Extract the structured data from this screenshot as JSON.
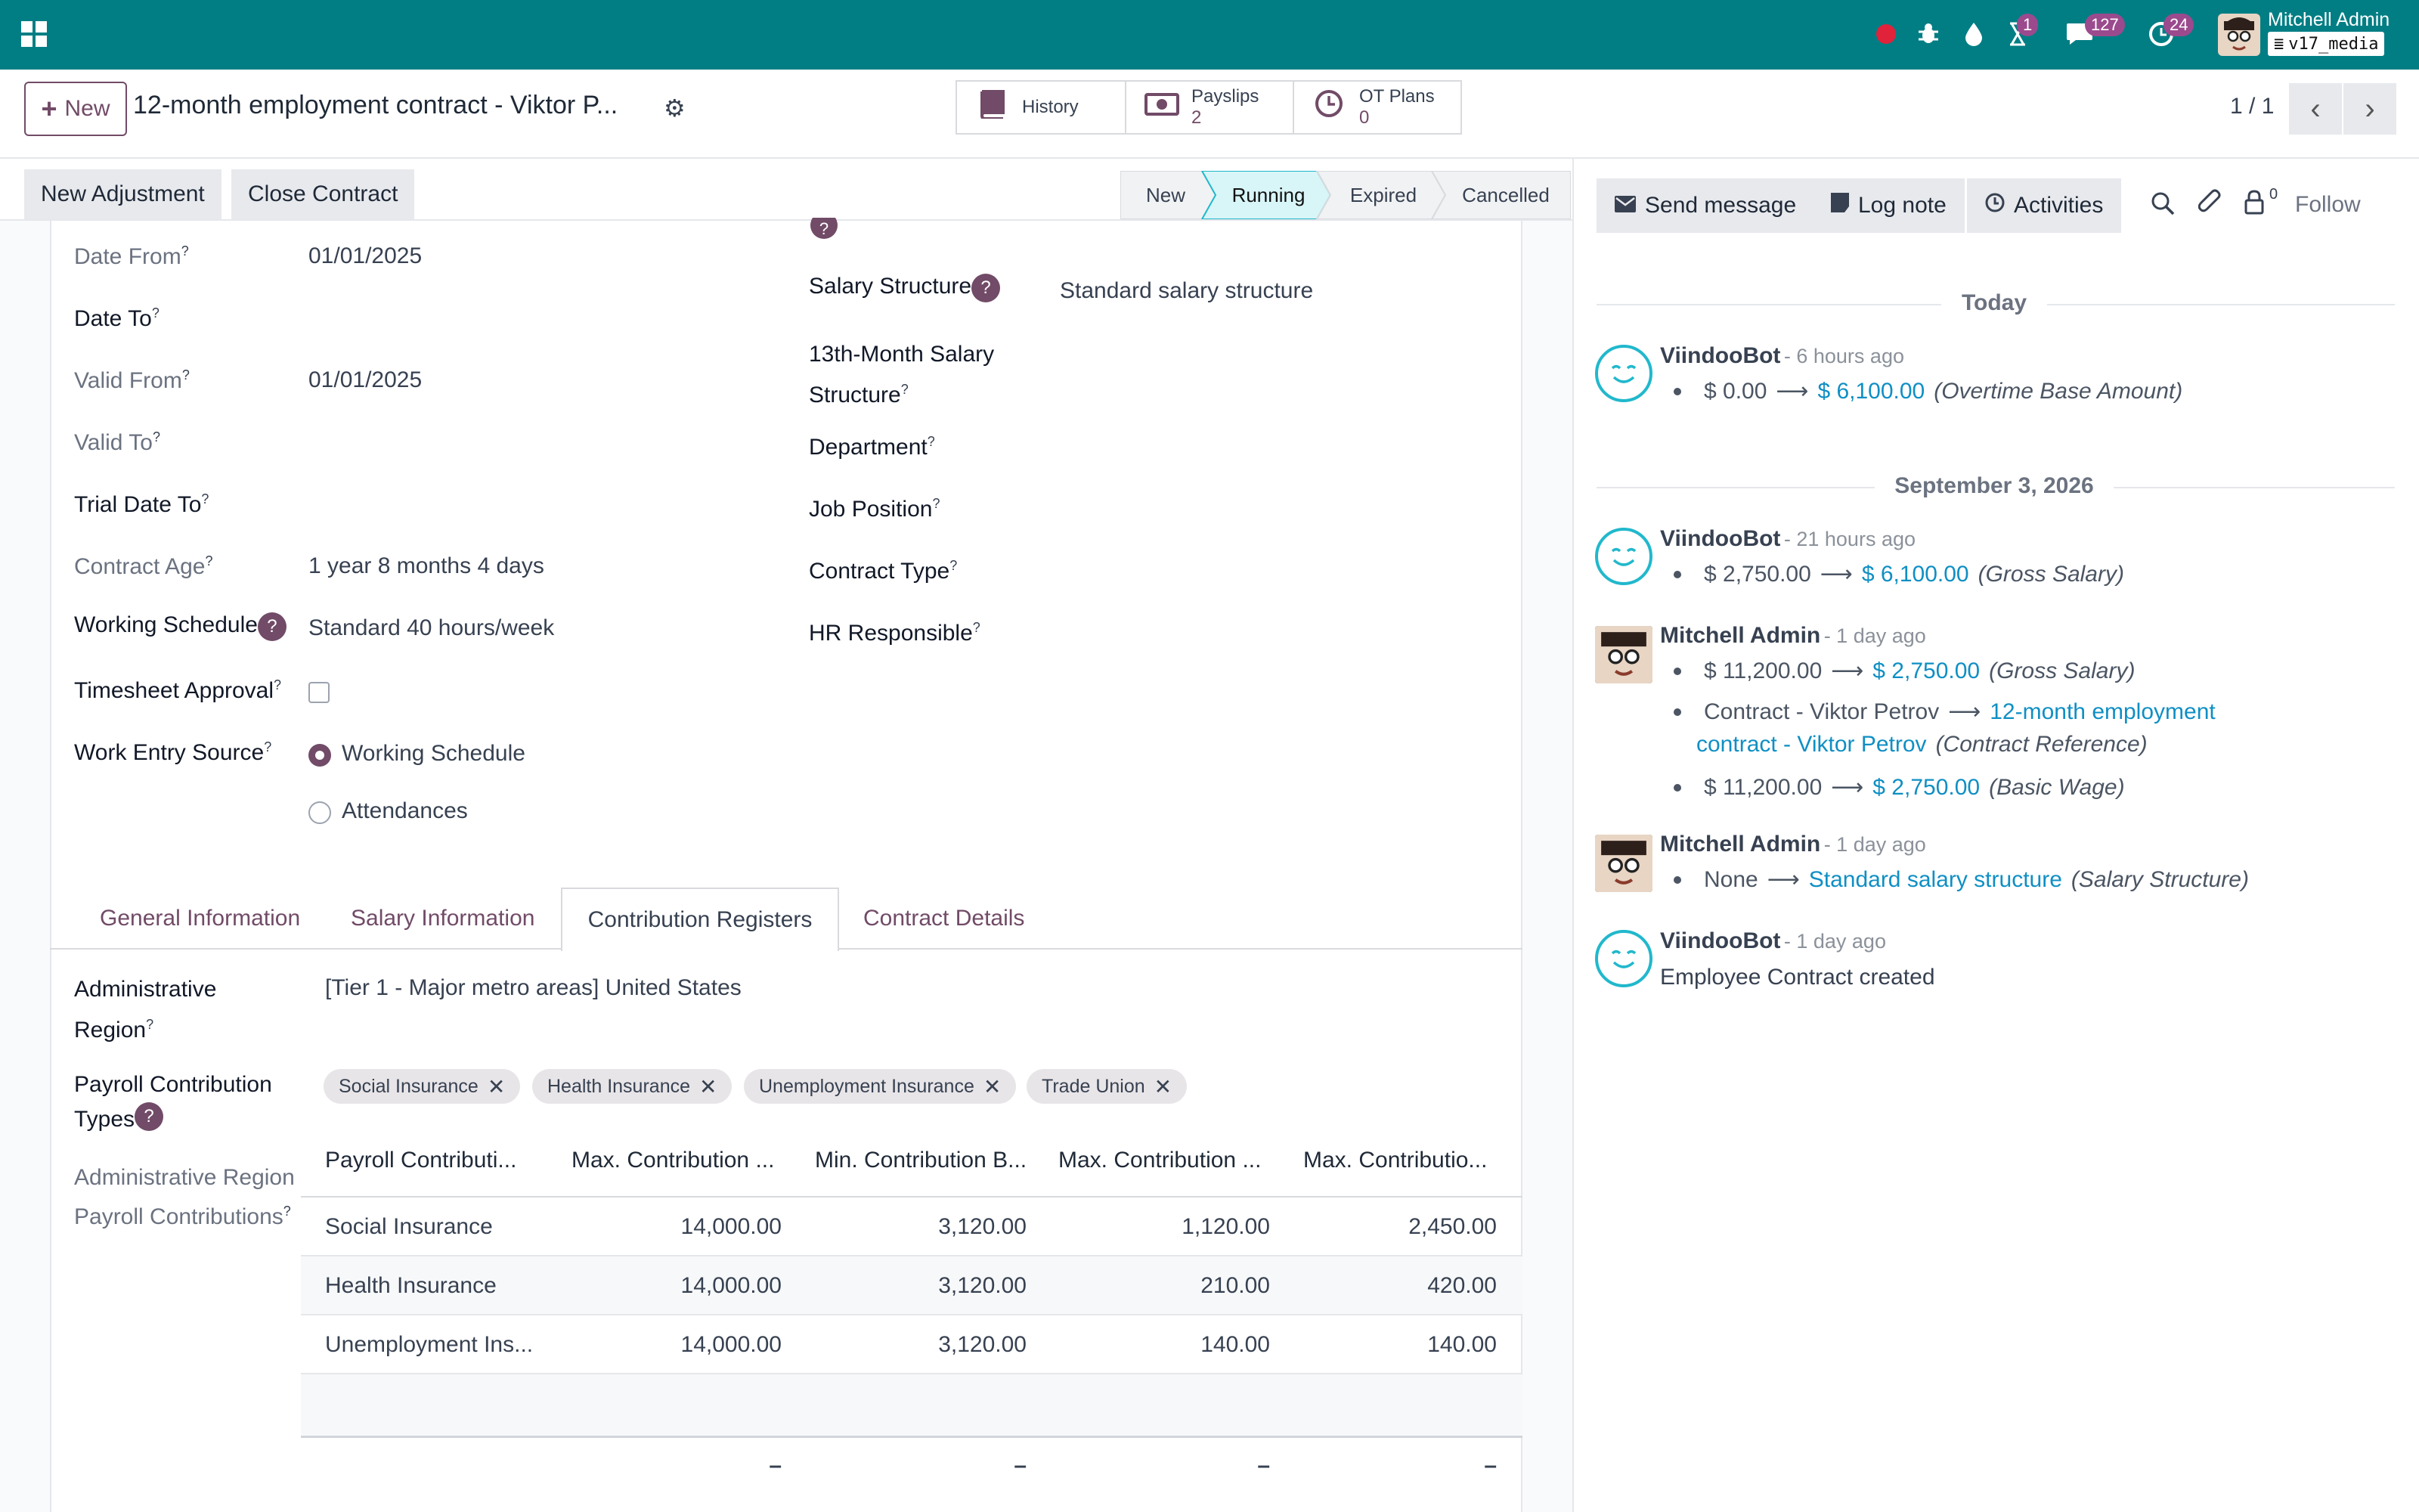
{
  "navbar": {
    "badges": {
      "activities": "1",
      "messages": "127",
      "updates": "24"
    },
    "user_name": "Mitchell Admin",
    "db_name": "v17_media"
  },
  "control": {
    "new_label": "New",
    "record_title": "12-month employment contract - Viktor P...",
    "smart_buttons": [
      {
        "label": "History",
        "count": ""
      },
      {
        "label": "Payslips",
        "count": "2"
      },
      {
        "label": "OT Plans",
        "count": "0"
      }
    ],
    "pager": "1 / 1"
  },
  "actions": {
    "adjustment": "New Adjustment",
    "close": "Close Contract"
  },
  "stages": [
    "New",
    "Running",
    "Expired",
    "Cancelled"
  ],
  "form_left": [
    {
      "label": "Date From",
      "value": "01/01/2025",
      "muted": true
    },
    {
      "label": "Date To",
      "value": "",
      "muted": false
    },
    {
      "label": "Valid From",
      "value": "01/01/2025",
      "muted": true
    },
    {
      "label": "Valid To",
      "value": "",
      "muted": true
    },
    {
      "label": "Trial Date To",
      "value": "",
      "muted": false
    },
    {
      "label": "Contract Age",
      "value": "1 year 8 months 4 days",
      "muted": true
    },
    {
      "label": "Working Schedule",
      "value": "Standard 40 hours/week",
      "muted": false
    },
    {
      "label": "Timesheet Approval",
      "value": "",
      "muted": false
    },
    {
      "label": "Work Entry Source",
      "value": "",
      "muted": false
    }
  ],
  "work_entry_options": [
    "Working Schedule",
    "Attendances"
  ],
  "form_right": {
    "salary_structure_label": "Salary Structure",
    "salary_structure_value": "Standard salary structure",
    "month13_label_1": "13th-Month Salary",
    "month13_label_2": "Structure",
    "department_label": "Department",
    "job_label": "Job Position",
    "type_label": "Contract Type",
    "hr_label": "HR Responsible"
  },
  "tabs": [
    "General Information",
    "Salary Information",
    "Contribution Registers",
    "Contract Details"
  ],
  "contrib": {
    "region_label_1": "Administrative",
    "region_label_2": "Region",
    "region_value": "[Tier 1 - Major metro areas] United States",
    "types_label_1": "Payroll Contribution",
    "types_label_2": "Types",
    "tags": [
      "Social Insurance",
      "Health Insurance",
      "Unemployment Insurance",
      "Trade Union"
    ],
    "table_label_1": "Administrative Region",
    "table_label_2": "Payroll Contributions",
    "columns": [
      "Payroll Contributi...",
      "Max. Contribution ...",
      "Min. Contribution B...",
      "Max. Contribution ...",
      "Max. Contributio..."
    ],
    "rows": [
      [
        "Social Insurance",
        "14,000.00",
        "3,120.00",
        "1,120.00",
        "2,450.00"
      ],
      [
        "Health Insurance",
        "14,000.00",
        "3,120.00",
        "210.00",
        "420.00"
      ],
      [
        "Unemployment Ins...",
        "14,000.00",
        "3,120.00",
        "140.00",
        "140.00"
      ]
    ],
    "totals": [
      "–",
      "–",
      "–",
      "–"
    ]
  },
  "chatter": {
    "send_message": "Send message",
    "log_note": "Log note",
    "activities": "Activities",
    "follower_count": "0",
    "follow": "Follow",
    "sep_today": "Today",
    "sep_date": "September 3, 2026",
    "msg1": {
      "author": "ViindooBot",
      "ago": "- 6 hours ago",
      "old": "$ 0.00",
      "new": "$ 6,100.00",
      "field": "(Overtime Base Amount)"
    },
    "msg2": {
      "author": "ViindooBot",
      "ago": "- 21 hours ago",
      "old": "$ 2,750.00",
      "new": "$ 6,100.00",
      "field": "(Gross Salary)"
    },
    "msg3": {
      "author": "Mitchell Admin",
      "ago": "- 1 day ago",
      "l1_old": "$ 11,200.00",
      "l1_new": "$ 2,750.00",
      "l1_field": "(Gross Salary)",
      "l2_old": "Contract - Viktor Petrov",
      "l2_new_a": "12-month employment",
      "l2_new_b": "contract - Viktor Petrov",
      "l2_field": "(Contract Reference)",
      "l3_old": "$ 11,200.00",
      "l3_new": "$ 2,750.00",
      "l3_field": "(Basic Wage)"
    },
    "msg4": {
      "author": "Mitchell Admin",
      "ago": "- 1 day ago",
      "old": "None",
      "new": "Standard salary structure",
      "field": "(Salary Structure)"
    },
    "msg5": {
      "author": "ViindooBot",
      "ago": "- 1 day ago",
      "body": "Employee Contract created"
    }
  },
  "colors": {
    "navbar": "#017e84",
    "brand": "#714b67",
    "link": "#0f8fc4",
    "active_stage": "#d8f5f7"
  }
}
